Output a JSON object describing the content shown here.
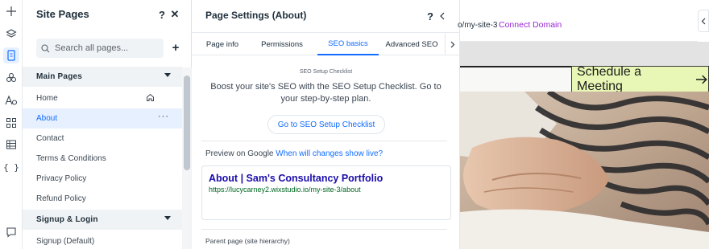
{
  "rail": {
    "icons": [
      "add-icon",
      "layers-icon",
      "pages-icon",
      "design-icon",
      "text-theme-icon",
      "apps-icon",
      "table-icon",
      "code-icon",
      "chat-icon"
    ]
  },
  "site_pages": {
    "title": "Site Pages",
    "help_label": "?",
    "close_label": "✕",
    "search_placeholder": "Search all pages...",
    "add_label": "+",
    "sections": [
      {
        "label": "Main Pages",
        "items": [
          "Home",
          "About",
          "Contact",
          "Terms & Conditions",
          "Privacy Policy",
          "Refund Policy"
        ]
      },
      {
        "label": "Signup & Login",
        "items": [
          "Signup (Default)"
        ]
      }
    ],
    "selected_item": "About",
    "more_label": "···"
  },
  "page_settings": {
    "title": "Page Settings (About)",
    "help_label": "?",
    "tabs": [
      "Page info",
      "Permissions",
      "SEO basics",
      "Advanced SEO"
    ],
    "active_tab": "SEO basics",
    "checklist_label": "SEO Setup Checklist",
    "checklist_desc": "Boost your site's SEO with the SEO Setup Checklist. Go to your step-by-step plan.",
    "checklist_button": "Go to SEO Setup Checklist",
    "preview_label": "Preview on Google",
    "preview_link": "When will changes show live?",
    "google_title": "About | Sam's Consultancy Portfolio",
    "google_url": "https://lucycarney2.wixstudio.io/my-site-3/about",
    "parent_label": "Parent page (site hierarchy)"
  },
  "canvas": {
    "url_fragment": "o/my-site-3",
    "connect_label": "Connect Domain",
    "schedule_label": "Schedule a Meeting"
  },
  "colors": {
    "accent": "#116dff",
    "connect": "#9a27d5",
    "schedule_bg": "#e8f7b5",
    "google_title": "#1a0dab",
    "google_url": "#006621"
  }
}
